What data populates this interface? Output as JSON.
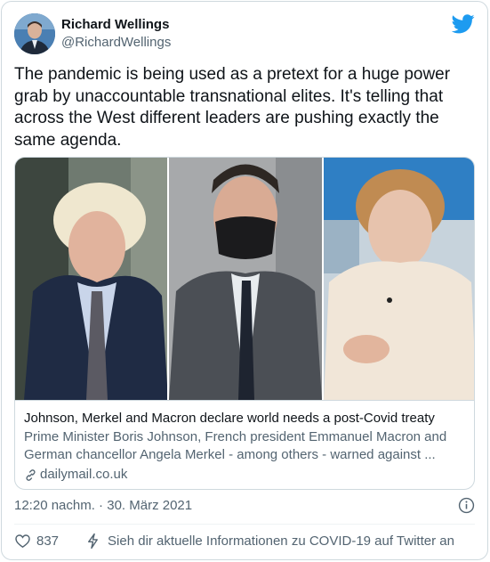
{
  "author": {
    "name": "Richard Wellings",
    "handle": "@RichardWellings"
  },
  "tweet": {
    "text": "The pandemic is being used as a pretext for a huge power grab by unaccountable transnational elites. It's telling that across the West different leaders are pushing exactly the same agenda."
  },
  "card": {
    "title": "Johnson, Merkel and Macron declare world needs a post-Covid treaty",
    "description": "Prime Minister Boris Johnson, French president Emmanuel Macron and German chancellor Angela Merkel - among others - warned against ...",
    "domain": "dailymail.co.uk"
  },
  "meta": {
    "timestamp": "12:20 nachm. · 30. März 2021"
  },
  "actions": {
    "like_count": "837",
    "covid_notice": "Sieh dir aktuelle Informationen zu COVID-19 auf Twitter an"
  },
  "colors": {
    "twitter_blue": "#1d9bf0",
    "secondary_text": "#536471",
    "border": "#cfd9de"
  },
  "icons": [
    "twitter-bird-icon",
    "info-icon",
    "heart-icon",
    "lightning-icon",
    "link-icon"
  ]
}
